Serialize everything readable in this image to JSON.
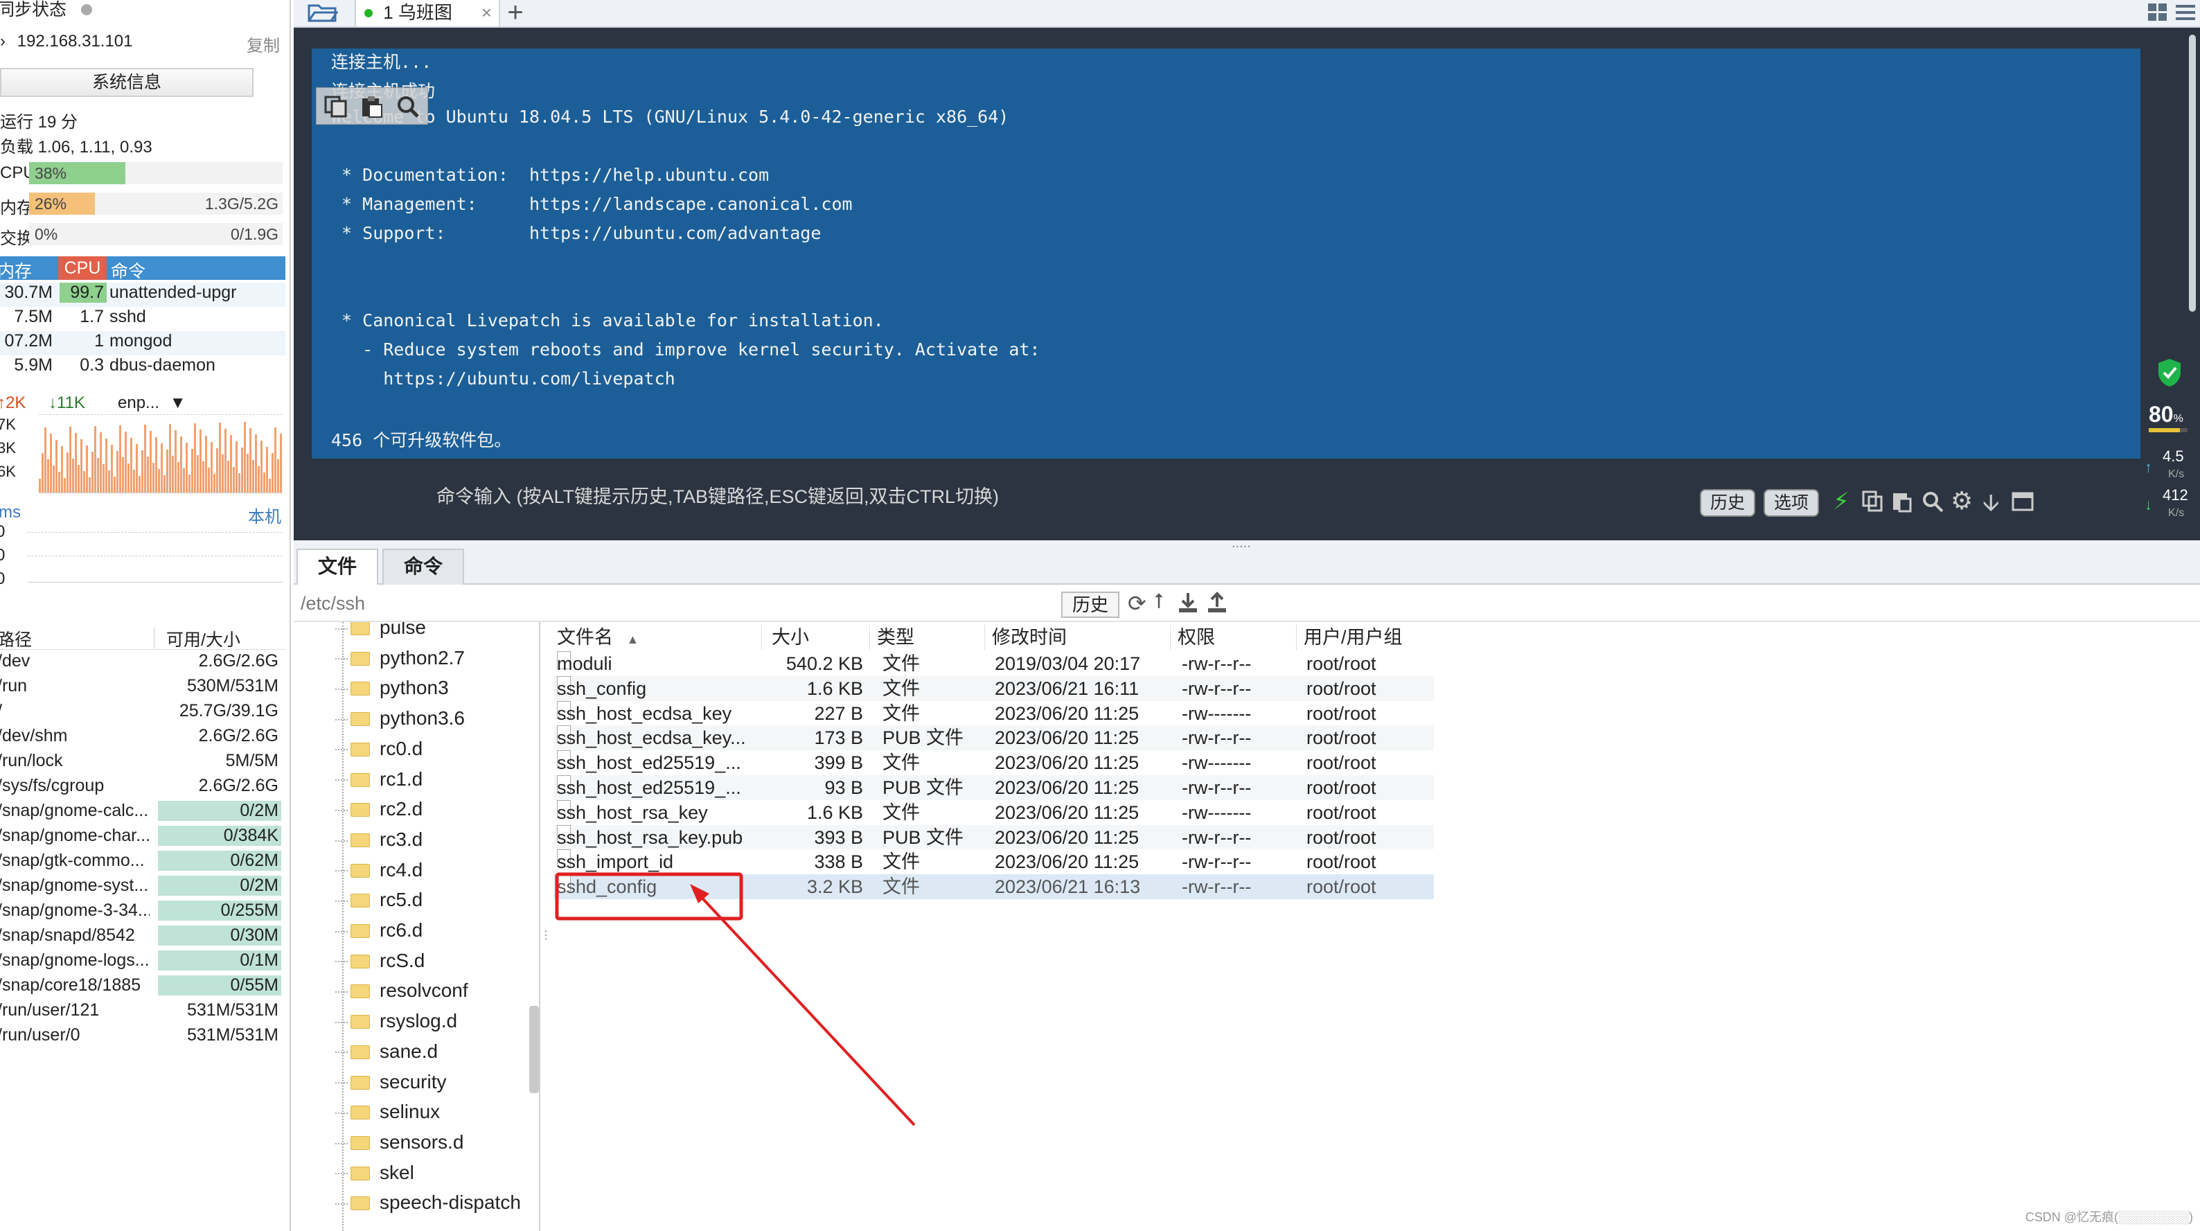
{
  "sidebar": {
    "sync_status": "同步状态",
    "ip": "192.168.31.101",
    "copy": "复制",
    "sysinfo_button": "系统信息",
    "uptime": "运行 19 分",
    "load": "负载 1.06, 1.11, 0.93",
    "cpu": {
      "label": "CPU",
      "pct": "38%",
      "fraction": 0.38
    },
    "mem": {
      "label": "内存",
      "pct": "26%",
      "fraction": 0.26,
      "value": "1.3G/5.2G"
    },
    "swap": {
      "label": "交换",
      "pct": "0%",
      "fraction": 0.0,
      "value": "0/1.9G"
    },
    "proc_header": {
      "mem": "内存",
      "cpu": "CPU",
      "cmd": "命令"
    },
    "processes": [
      {
        "mem": "30.7M",
        "cpu": "99.7",
        "cmd": "unattended-upgr"
      },
      {
        "mem": "7.5M",
        "cpu": "1.7",
        "cmd": "sshd"
      },
      {
        "mem": "07.2M",
        "cpu": "1",
        "cmd": "mongod"
      },
      {
        "mem": "5.9M",
        "cpu": "0.3",
        "cmd": "dbus-daemon"
      }
    ],
    "net": {
      "up": "↑2K",
      "down": "↓11K",
      "iface": "enp...",
      "y1": "7K",
      "y2": "3K",
      "y3": "6K"
    },
    "ping": {
      "label": "ms",
      "host": "本机",
      "vals": [
        "0",
        "0",
        "0"
      ]
    },
    "disk_header": {
      "path": "路径",
      "size": "可用/大小"
    },
    "disks": [
      {
        "path": "/dev",
        "size": "2.6G/2.6G"
      },
      {
        "path": "/run",
        "size": "530M/531M"
      },
      {
        "path": "/",
        "size": "25.7G/39.1G"
      },
      {
        "path": "/dev/shm",
        "size": "2.6G/2.6G"
      },
      {
        "path": "/run/lock",
        "size": "5M/5M"
      },
      {
        "path": "/sys/fs/cgroup",
        "size": "2.6G/2.6G"
      },
      {
        "path": "/snap/gnome-calc...",
        "size": "0/2M"
      },
      {
        "path": "/snap/gnome-char...",
        "size": "0/384K"
      },
      {
        "path": "/snap/gtk-commo...",
        "size": "0/62M"
      },
      {
        "path": "/snap/gnome-syst...",
        "size": "0/2M"
      },
      {
        "path": "/snap/gnome-3-34...",
        "size": "0/255M"
      },
      {
        "path": "/snap/snapd/8542",
        "size": "0/30M"
      },
      {
        "path": "/snap/gnome-logs...",
        "size": "0/1M"
      },
      {
        "path": "/snap/core18/1885",
        "size": "0/55M"
      },
      {
        "path": "/run/user/121",
        "size": "531M/531M"
      },
      {
        "path": "/run/user/0",
        "size": "531M/531M"
      }
    ]
  },
  "topbar": {
    "tab_label": "1 乌班图"
  },
  "terminal": {
    "lines": [
      "连接主机...",
      "连接主机成功",
      "Welcome to Ubuntu 18.04.5 LTS (GNU/Linux 5.4.0-42-generic x86_64)",
      "",
      " * Documentation:  https://help.ubuntu.com",
      " * Management:     https://landscape.canonical.com",
      " * Support:        https://ubuntu.com/advantage",
      "",
      "",
      " * Canonical Livepatch is available for installation.",
      "   - Reduce system reboots and improve kernel security. Activate at:",
      "     https://ubuntu.com/livepatch",
      "",
      "456 个可升级软件包。"
    ],
    "cmd_hint": "命令输入 (按ALT键提示历史,TAB键路径,ESC键返回,双击CTRL切换)",
    "history_btn": "历史",
    "options_btn": "选项"
  },
  "stats": {
    "percent": "80",
    "pct_unit": "%",
    "up": "4.5",
    "down": "412",
    "unit": "K/s"
  },
  "files": {
    "tab_files": "文件",
    "tab_cmds": "命令",
    "path": "/etc/ssh",
    "history_btn": "历史",
    "tree": [
      "pulse",
      "python2.7",
      "python3",
      "python3.6",
      "rc0.d",
      "rc1.d",
      "rc2.d",
      "rc3.d",
      "rc4.d",
      "rc5.d",
      "rc6.d",
      "rcS.d",
      "resolvconf",
      "rsyslog.d",
      "sane.d",
      "security",
      "selinux",
      "sensors.d",
      "skel",
      "speech-dispatch"
    ],
    "headers": {
      "name": "文件名",
      "size": "大小",
      "type": "类型",
      "time": "修改时间",
      "perm": "权限",
      "owner": "用户/用户组"
    },
    "rows": [
      {
        "name": "moduli",
        "size": "540.2 KB",
        "type": "文件",
        "time": "2019/03/04 20:17",
        "perm": "-rw-r--r--",
        "owner": "root/root"
      },
      {
        "name": "ssh_config",
        "size": "1.6 KB",
        "type": "文件",
        "time": "2023/06/21 16:11",
        "perm": "-rw-r--r--",
        "owner": "root/root"
      },
      {
        "name": "ssh_host_ecdsa_key",
        "size": "227 B",
        "type": "文件",
        "time": "2023/06/20 11:25",
        "perm": "-rw-------",
        "owner": "root/root"
      },
      {
        "name": "ssh_host_ecdsa_key...",
        "size": "173 B",
        "type": "PUB 文件",
        "time": "2023/06/20 11:25",
        "perm": "-rw-r--r--",
        "owner": "root/root"
      },
      {
        "name": "ssh_host_ed25519_...",
        "size": "399 B",
        "type": "文件",
        "time": "2023/06/20 11:25",
        "perm": "-rw-------",
        "owner": "root/root"
      },
      {
        "name": "ssh_host_ed25519_...",
        "size": "93 B",
        "type": "PUB 文件",
        "time": "2023/06/20 11:25",
        "perm": "-rw-r--r--",
        "owner": "root/root"
      },
      {
        "name": "ssh_host_rsa_key",
        "size": "1.6 KB",
        "type": "文件",
        "time": "2023/06/20 11:25",
        "perm": "-rw-------",
        "owner": "root/root"
      },
      {
        "name": "ssh_host_rsa_key.pub",
        "size": "393 B",
        "type": "PUB 文件",
        "time": "2023/06/20 11:25",
        "perm": "-rw-r--r--",
        "owner": "root/root"
      },
      {
        "name": "ssh_import_id",
        "size": "338 B",
        "type": "文件",
        "time": "2023/06/20 11:25",
        "perm": "-rw-r--r--",
        "owner": "root/root"
      },
      {
        "name": "sshd_config",
        "size": "3.2 KB",
        "type": "文件",
        "time": "2023/06/21 16:13",
        "perm": "-rw-r--r--",
        "owner": "root/root",
        "selected": true
      }
    ]
  },
  "watermark": "CSDN @忆无痕(░░░░░░░░)",
  "colors": {
    "accent": "#3e8ed0",
    "terminal_blue": "#1c5f98",
    "annotation_red": "#e02020",
    "cpu_bar": "#8fd08f",
    "mem_bar": "#f5c07a",
    "selected_row": "#dce9f5"
  }
}
